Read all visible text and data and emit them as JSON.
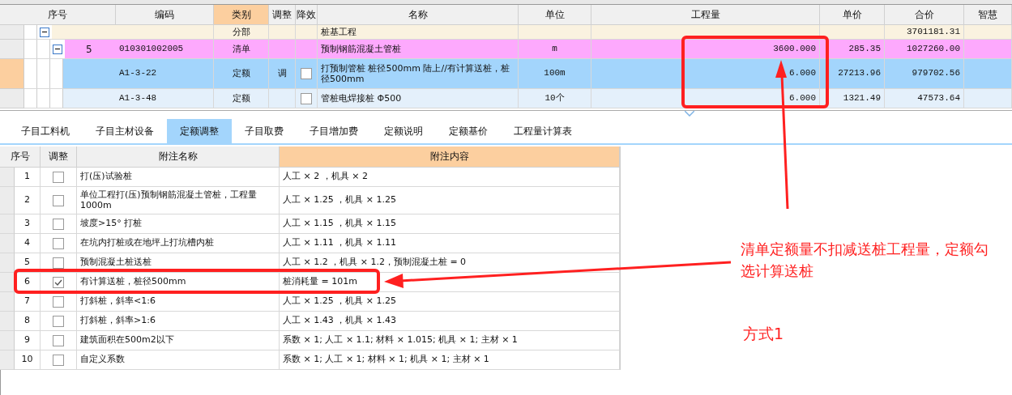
{
  "grid": {
    "columns": [
      "序号",
      "编码",
      "类别",
      "调整",
      "降效",
      "名称",
      "单位",
      "工程量",
      "单价",
      "合价",
      "智慧"
    ],
    "rows": [
      {
        "kind": "section",
        "selected": false,
        "expanded": true,
        "type": "分部",
        "name": "桩基工程",
        "total": "3701181.31",
        "children": [
          {
            "kind": "bill",
            "selected": false,
            "expanded": true,
            "seq": "5",
            "code": "010301002005",
            "type": "清单",
            "name": "预制钢筋混凝土管桩",
            "unit": "m",
            "quantity": "3600.000",
            "unit_price": "285.35",
            "total": "1027260.00",
            "children": [
              {
                "kind": "quota",
                "selected": true,
                "code": "A1-3-22",
                "type": "定额",
                "adjust": "调",
                "reduced": false,
                "name": "打预制管桩 桩径500mm 陆上//有计算送桩，桩径500mm",
                "unit": "100m",
                "quantity": "6.000",
                "unit_price": "27213.96",
                "total": "979702.56"
              },
              {
                "kind": "quota",
                "selected": false,
                "code": "A1-3-48",
                "type": "定额",
                "reduced": false,
                "name": "管桩电焊接桩 Φ500",
                "unit": "10个",
                "quantity": "6.000",
                "unit_price": "1321.49",
                "total": "47573.64"
              }
            ]
          }
        ]
      }
    ]
  },
  "tabs": [
    {
      "label": "子目工料机",
      "selected": false
    },
    {
      "label": "子目主材设备",
      "selected": false
    },
    {
      "label": "定额调整",
      "selected": true
    },
    {
      "label": "子目取费",
      "selected": false
    },
    {
      "label": "子目增加费",
      "selected": false
    },
    {
      "label": "定额说明",
      "selected": false
    },
    {
      "label": "定额基价",
      "selected": false
    },
    {
      "label": "工程量计算表",
      "selected": false
    }
  ],
  "adjustments": {
    "columns": [
      "序号",
      "调整",
      "附注名称",
      "附注内容"
    ],
    "rows": [
      {
        "no": "1",
        "checked": false,
        "name": "打(压)试验桩",
        "content": "人工 × 2 ，机具 × 2"
      },
      {
        "no": "2",
        "checked": false,
        "name": "单位工程打(压)预制钢筋混凝土管桩，工程量1000m",
        "content": "人工 × 1.25 ，机具 × 1.25"
      },
      {
        "no": "3",
        "checked": false,
        "name": "坡度>15° 打桩",
        "content": "人工 × 1.15 ，机具 × 1.15"
      },
      {
        "no": "4",
        "checked": false,
        "name": "在坑内打桩或在地坪上打坑槽内桩",
        "content": "人工 × 1.11 ，机具 × 1.11"
      },
      {
        "no": "5",
        "checked": false,
        "name": "预制混凝土桩送桩",
        "content": "人工 × 1.2 ，机具 × 1.2，预制混凝土桩 = 0"
      },
      {
        "no": "6",
        "checked": true,
        "name": "有计算送桩，桩径500mm",
        "content": "桩消耗量 = 101m"
      },
      {
        "no": "7",
        "checked": false,
        "name": "打斜桩，斜率<1:6",
        "content": "人工 × 1.25 ，机具 × 1.25"
      },
      {
        "no": "8",
        "checked": false,
        "name": "打斜桩，斜率>1:6",
        "content": "人工 × 1.43 ，机具 × 1.43"
      },
      {
        "no": "9",
        "checked": false,
        "name": "建筑面积在500m2以下",
        "content": "系数 × 1; 人工 × 1.1; 材料 × 1.015; 机具 × 1; 主材 × 1"
      },
      {
        "no": "10",
        "checked": false,
        "name": "自定义系数",
        "content": "系数 × 1; 人工 × 1; 材料 × 1; 机具 × 1; 主材 × 1"
      }
    ]
  },
  "annotations": {
    "note": "清单定额量不扣减送桩工程量，定额勾选计算送桩",
    "label": "方式1"
  }
}
